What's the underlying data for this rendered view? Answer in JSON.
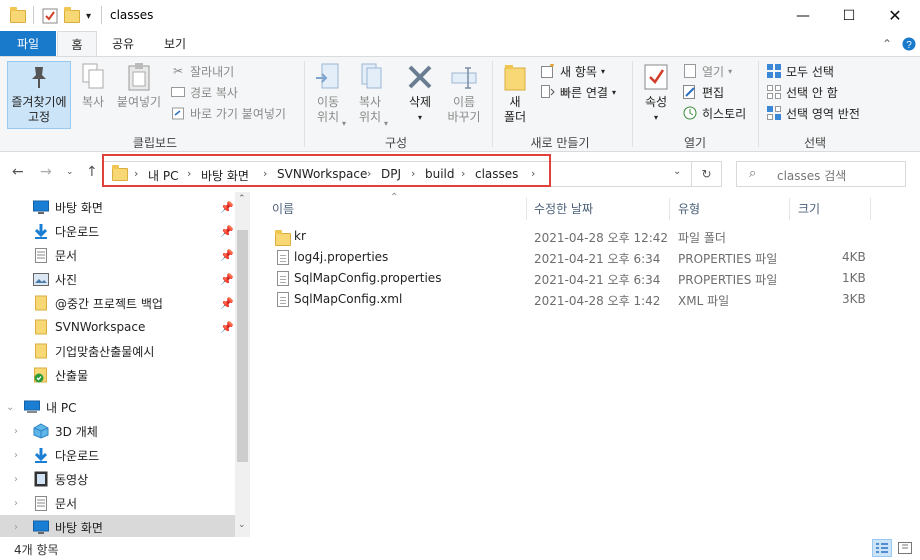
{
  "window": {
    "title": "classes"
  },
  "ribbon_tabs": [
    "파일",
    "홈",
    "공유",
    "보기"
  ],
  "ribbon": {
    "clipboard": {
      "pin_label_1": "즐겨찾기에",
      "pin_label_2": "고정",
      "copy": "복사",
      "paste": "붙여넣기",
      "cut": "잘라내기",
      "copy_path": "경로 복사",
      "paste_shortcut": "바로 가기 붙여넣기",
      "group": "클립보드"
    },
    "organize": {
      "move_1": "이동",
      "move_2": "위치",
      "copy_1": "복사",
      "copy_2": "위치",
      "delete": "삭제",
      "rename_1": "이름",
      "rename_2": "바꾸기",
      "group": "구성"
    },
    "new": {
      "folder_1": "새",
      "folder_2": "폴더",
      "new_item": "새 항목",
      "easy_access": "빠른 연결",
      "group": "새로 만들기"
    },
    "open": {
      "properties": "속성",
      "open": "열기",
      "edit": "편집",
      "history": "히스토리",
      "group": "열기"
    },
    "select": {
      "select_all": "모두 선택",
      "select_none": "선택 안 함",
      "invert": "선택 영역 반전",
      "group": "선택"
    }
  },
  "address": {
    "crumbs": [
      "내 PC",
      "바탕 화면",
      "SVNWorkspace",
      "DPJ",
      "build",
      "classes"
    ],
    "search_placeholder": "classes 검색"
  },
  "nav_pane": {
    "quick_access": [
      "바탕 화면",
      "다운로드",
      "문서",
      "사진",
      "@중간 프로젝트 백업",
      "SVNWorkspace",
      "기업맞춤산출물예시",
      "산출물"
    ],
    "this_pc": "내 PC",
    "pc_items": [
      "3D 개체",
      "다운로드",
      "동영상",
      "문서",
      "바탕 화면"
    ]
  },
  "columns": {
    "name": "이름",
    "date": "수정한 날짜",
    "type": "유형",
    "size": "크기"
  },
  "files": [
    {
      "name": "kr",
      "date": "2021-04-28 오후 12:42",
      "type": "파일 폴더",
      "size": ""
    },
    {
      "name": "log4j.properties",
      "date": "2021-04-21 오후 6:34",
      "type": "PROPERTIES 파일",
      "size": "4KB"
    },
    {
      "name": "SqlMapConfig.properties",
      "date": "2021-04-21 오후 6:34",
      "type": "PROPERTIES 파일",
      "size": "1KB"
    },
    {
      "name": "SqlMapConfig.xml",
      "date": "2021-04-28 오후 1:42",
      "type": "XML 파일",
      "size": "3KB"
    }
  ],
  "status": {
    "count": "4개 항목"
  },
  "colors": {
    "file_tab": "#1979ca",
    "highlight_box": "#e0413a",
    "folder": "#f8d775"
  }
}
